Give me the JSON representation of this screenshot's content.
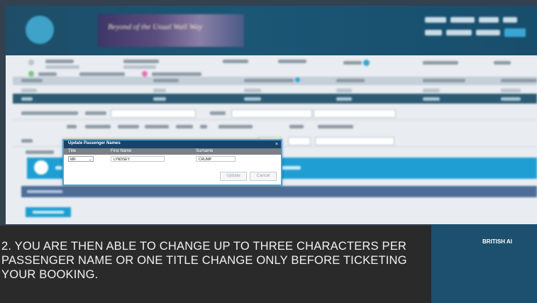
{
  "dialog": {
    "title": "Update Passenger Names",
    "close_label": "×",
    "columns": {
      "title": "Title",
      "first_name": "First Name",
      "surname": "Surname"
    },
    "row": {
      "title": "MR",
      "first_name": "LYNDSEY",
      "surname": "CRUMP"
    },
    "update_label": "Update",
    "cancel_label": "Cancel"
  },
  "caption": "2. YOU ARE THEN ABLE TO CHANGE UP TO THREE CHARACTERS PER PASSENGER NAME OR ONE TITLE CHANGE ONLY BEFORE TICKETING YOUR BOOKING.",
  "brand": "BRITISH AI",
  "colors": {
    "header": "#1b5675",
    "accent": "#1e9ed2",
    "dialog_title": "#18446b",
    "caption_bg": "#2a2a2a"
  },
  "icons": {
    "dialog_close": "close-icon",
    "title_select": "chevron-down-icon",
    "info": "info-icon"
  }
}
